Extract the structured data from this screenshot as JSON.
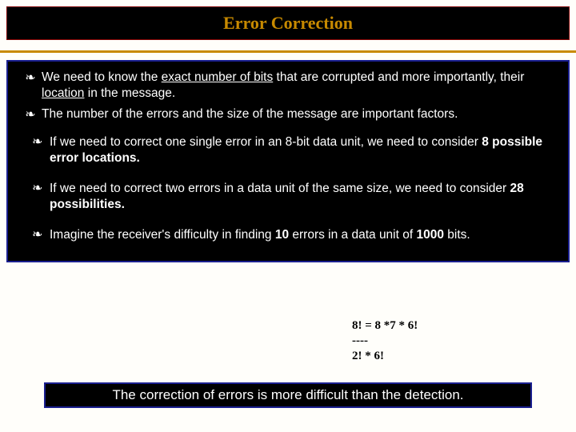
{
  "title": "Error Correction",
  "main": {
    "bullets": [
      {
        "pre": "We  need to know the ",
        "under1": "exact number of bits",
        "mid1": " that are corrupted and more importantly, their ",
        "under2": "location",
        "post": " in the message."
      },
      {
        "text": "The number of the errors and the size of the message are important factors."
      }
    ],
    "subs": [
      {
        "pre": "If we need to correct one single error in an 8-bit data unit, we need to consider ",
        "bold": "8 possible error locations.",
        "post": ""
      },
      {
        "pre": "If we need to correct two errors in a data unit of the same size, we need to consider ",
        "bold": "28 possibilities.",
        "post": ""
      },
      {
        "pre": "Imagine the receiver's difficulty in finding ",
        "bold1": "10",
        "mid": " errors in a data unit of ",
        "bold2": "1000",
        "post": " bits."
      }
    ]
  },
  "calc": {
    "line1": "8!   =  8 *7 * 6!",
    "line2": "----",
    "line3": "2! * 6!"
  },
  "footer": "The correction of errors is more difficult than the detection."
}
